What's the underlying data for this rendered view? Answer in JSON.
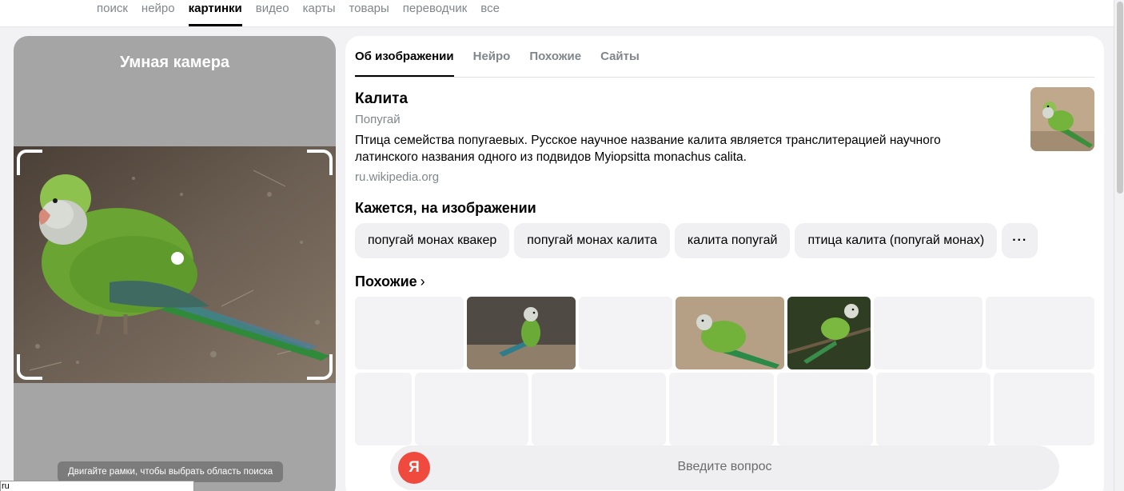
{
  "nav": {
    "items": [
      "поиск",
      "нейро",
      "картинки",
      "видео",
      "карты",
      "товары",
      "переводчик",
      "все"
    ],
    "active": "картинки"
  },
  "camera": {
    "title": "Умная камера",
    "hint": "Двигайте рамки, чтобы выбрать область поиска"
  },
  "status_url": "ru",
  "tabs": [
    "Об изображении",
    "Нейро",
    "Похожие",
    "Сайты"
  ],
  "entity": {
    "title": "Калита",
    "subtitle": "Попугай",
    "description": "Птица семейства попугаевых. Русское научное название калита является транслитерацией научного латинского названия одного из подвидов Myiopsitta monachus calita.",
    "source": "ru.wikipedia.org"
  },
  "seems": {
    "title": "Кажется, на изображении",
    "chips": [
      "попугай монах квакер",
      "попугай монах калита",
      "калита попугай",
      "птица калита (попугай монах)"
    ],
    "more_icon": "more-dots-icon",
    "more_label": "···"
  },
  "similar": {
    "title": "Похожие",
    "chevron": "›"
  },
  "ask": {
    "placeholder": "Введите вопрос",
    "logo": "Я"
  },
  "colors": {
    "accent_underline": "#000000",
    "camera_bg": "#a5a5a5",
    "chip_bg": "#f0f0f2",
    "logo_red": "#f0493d"
  }
}
